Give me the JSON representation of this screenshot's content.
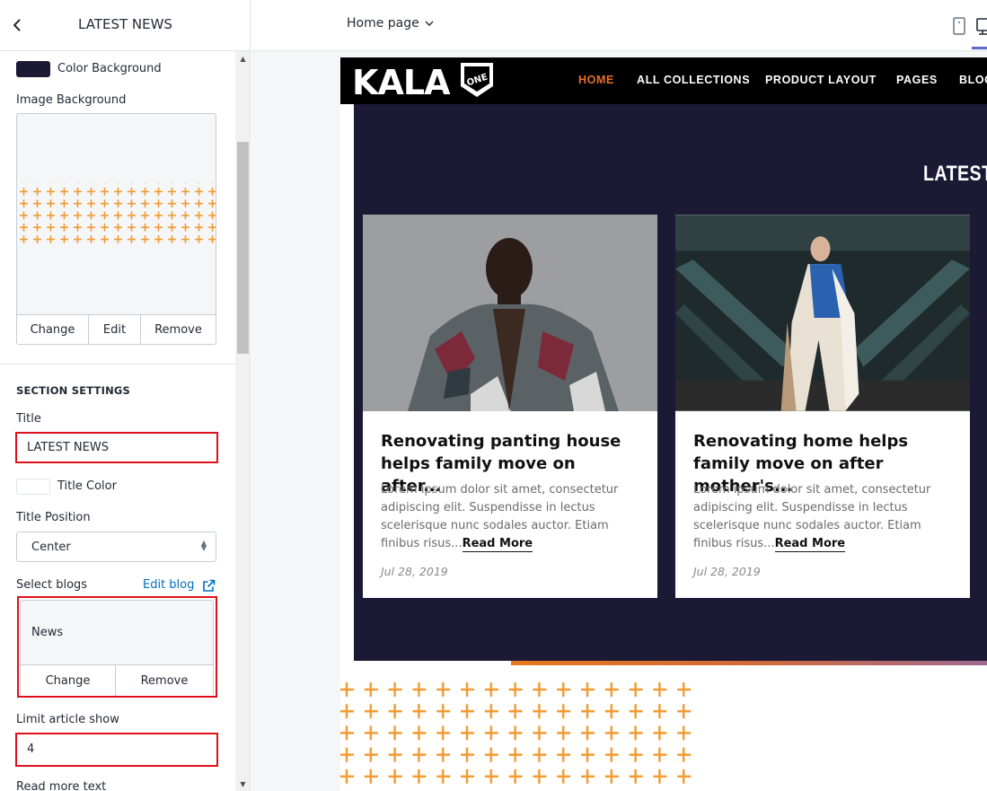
{
  "sidebar": {
    "title": "LATEST NEWS",
    "color_background_label": "Color Background",
    "color_background_value": "#1b1934",
    "image_background_label": "Image Background",
    "image_actions": {
      "change": "Change",
      "edit": "Edit",
      "remove": "Remove"
    },
    "section_settings_heading": "SECTION SETTINGS",
    "title_label": "Title",
    "title_value": "LATEST NEWS",
    "title_color_label": "Title Color",
    "title_color_value": "#ffffff",
    "title_position_label": "Title Position",
    "title_position_value": "Center",
    "select_blogs_label": "Select blogs",
    "edit_blog_link": "Edit blog",
    "selected_blog": "News",
    "blog_actions": {
      "change": "Change",
      "remove": "Remove"
    },
    "limit_label": "Limit article show",
    "limit_value": "4",
    "read_more_text_label": "Read more text"
  },
  "topbar": {
    "page_select": "Home page"
  },
  "store": {
    "logo_text": "KALA",
    "logo_badge": "ONE",
    "nav": [
      "HOME",
      "ALL COLLECTIONS",
      "PRODUCT LAYOUT",
      "PAGES",
      "BLOG"
    ],
    "section_title": "LATEST",
    "articles": [
      {
        "title": "Renovating panting house helps family move on after...",
        "excerpt": "Lorem ipsum dolor sit amet, consectetur adipiscing elit. Suspendisse in lectus scelerisque nunc sodales auctor. Etiam finibus risus...",
        "read_more": "Read More",
        "date": "Jul 28, 2019"
      },
      {
        "title": "Renovating home helps family move on after mother's...",
        "excerpt": "Lorem ipsum dolor sit amet, consectetur adipiscing elit. Suspendisse in lectus scelerisque nunc sodales auctor. Etiam finibus risus...",
        "read_more": "Read More",
        "date": "Jul 28, 2019"
      }
    ]
  },
  "colors": {
    "accent_orange": "#f2992e",
    "nav_active": "#e8702a",
    "section_bg": "#1b1934",
    "highlight_red": "#e0101a",
    "link_blue": "#006fbb"
  },
  "icons": [
    "chevron-left-icon",
    "chevron-down-icon",
    "external-link-icon",
    "mobile-view-icon",
    "desktop-view-icon",
    "plus-pattern"
  ]
}
